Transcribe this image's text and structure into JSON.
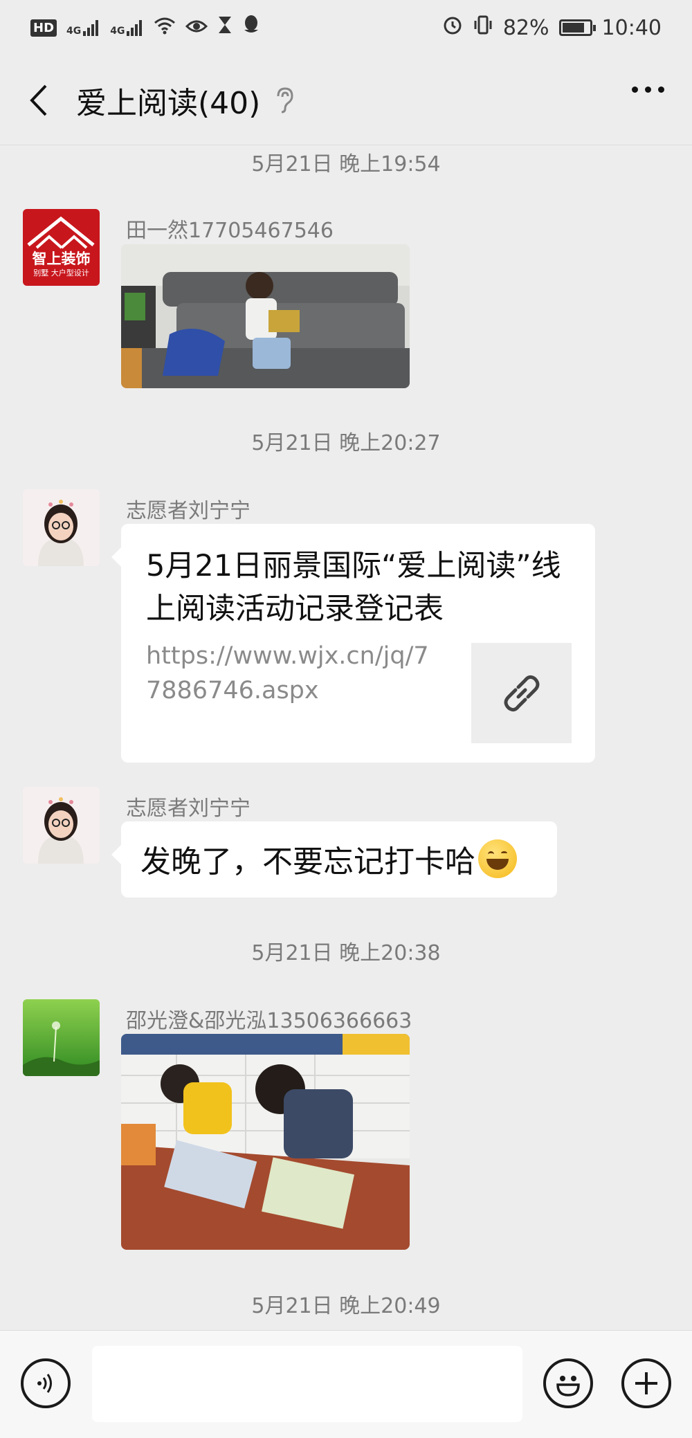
{
  "status_bar": {
    "left_icons": [
      "hd-icon",
      "signal-4g-icon",
      "signal-4g-icon",
      "wifi-icon",
      "eye-icon",
      "hourglass-icon",
      "qq-icon"
    ],
    "labels": {
      "hd": "HD",
      "net1": "4G",
      "net2": "4G"
    },
    "battery_percent": "82%",
    "battery_level": 0.82,
    "time": "10:40"
  },
  "header": {
    "title": "爱上阅读(40)",
    "mute_icon": "ear-icon",
    "back_icon": "chevron-left-icon",
    "more_icon": "more-dots-icon"
  },
  "messages": [
    {
      "type": "timestamp",
      "text": "5月21日 晚上19:54"
    },
    {
      "type": "image",
      "sender": "田一然17705467546",
      "avatar_text": "智上装饰",
      "avatar_sub": "别墅 大户型设计"
    },
    {
      "type": "timestamp",
      "text": "5月21日 晚上20:27"
    },
    {
      "type": "link",
      "sender": "志愿者刘宁宁",
      "title": "5月21日丽景国际“爱上阅读”线上阅读活动记录登记表",
      "url": "https://www.wjx.cn/jq/77886746.aspx",
      "icon": "link-icon"
    },
    {
      "type": "text",
      "sender": "志愿者刘宁宁",
      "text": "发晚了，不要忘记打卡哈",
      "emoji": "grin-emoji-icon"
    },
    {
      "type": "timestamp",
      "text": "5月21日 晚上20:38"
    },
    {
      "type": "image",
      "sender": "邵光澄&邵光泓13506366663"
    },
    {
      "type": "timestamp",
      "text": "5月21日 晚上20:49"
    }
  ],
  "input_bar": {
    "voice_icon": "voice-icon",
    "emoji_icon": "smile-icon",
    "plus_icon": "plus-icon",
    "input_value": ""
  },
  "colors": {
    "background": "#ededed",
    "bubble": "#ffffff",
    "meta_text": "#7a7a7a",
    "avatar_brand": "#c8161d"
  }
}
